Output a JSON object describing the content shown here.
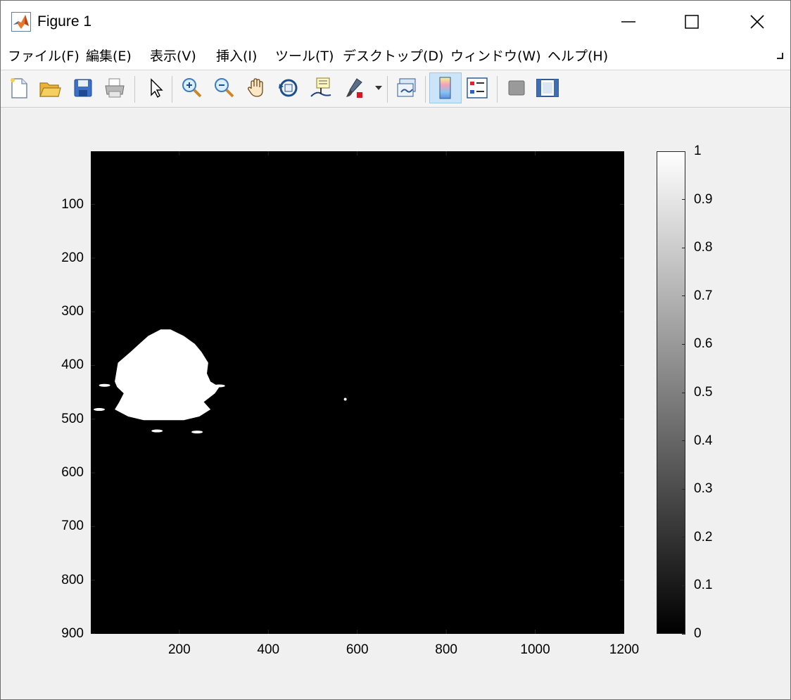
{
  "window": {
    "title": "Figure 1",
    "controls": {
      "minimize": "minimize",
      "maximize": "maximize",
      "close": "close"
    }
  },
  "menu": {
    "items": [
      "ファイル(F)",
      "編集(E)",
      "表示(V)",
      "挿入(I)",
      "ツール(T)",
      "デスクトップ(D)",
      "ウィンドウ(W)",
      "ヘルプ(H)"
    ]
  },
  "toolbar": {
    "buttons": [
      {
        "icon": "new-figure-icon"
      },
      {
        "icon": "open-file-icon"
      },
      {
        "icon": "save-icon"
      },
      {
        "icon": "print-icon"
      },
      {
        "icon": "edit-plot-arrow-icon"
      },
      {
        "icon": "zoom-in-icon"
      },
      {
        "icon": "zoom-out-icon"
      },
      {
        "icon": "pan-hand-icon"
      },
      {
        "icon": "rotate-3d-icon"
      },
      {
        "icon": "data-cursor-icon"
      },
      {
        "icon": "brush-icon"
      },
      {
        "icon": "link-plot-icon"
      },
      {
        "icon": "colorbar-icon",
        "active": true
      },
      {
        "icon": "legend-icon"
      },
      {
        "icon": "hide-plot-tools-icon"
      },
      {
        "icon": "show-plot-tools-icon"
      }
    ]
  },
  "chart_data": {
    "type": "heatmap",
    "title": "",
    "xlabel": "",
    "ylabel": "",
    "xlim": [
      1,
      1200
    ],
    "ylim": [
      1,
      900
    ],
    "y_reversed": true,
    "xticks": [
      200,
      400,
      600,
      800,
      1000,
      1200
    ],
    "yticks": [
      100,
      200,
      300,
      400,
      500,
      600,
      700,
      800,
      900
    ],
    "colormap": "gray",
    "background_value": 0,
    "foreground_value": 1,
    "white_region_profile": [
      {
        "y": 333,
        "x_from": 158,
        "x_to": 180
      },
      {
        "y": 345,
        "x_from": 130,
        "x_to": 210
      },
      {
        "y": 360,
        "x_from": 110,
        "x_to": 235
      },
      {
        "y": 375,
        "x_from": 90,
        "x_to": 250
      },
      {
        "y": 395,
        "x_from": 62,
        "x_to": 265
      },
      {
        "y": 415,
        "x_from": 58,
        "x_to": 262
      },
      {
        "y": 430,
        "x_from": 55,
        "x_to": 270
      },
      {
        "y": 440,
        "x_from": 60,
        "x_to": 290
      },
      {
        "y": 452,
        "x_from": 75,
        "x_to": 280
      },
      {
        "y": 468,
        "x_from": 65,
        "x_to": 255
      },
      {
        "y": 482,
        "x_from": 55,
        "x_to": 270
      },
      {
        "y": 495,
        "x_from": 85,
        "x_to": 245
      },
      {
        "y": 502,
        "x_from": 120,
        "x_to": 210
      }
    ],
    "extra_white_blobs": [
      {
        "x": 32,
        "y": 437
      },
      {
        "x": 290,
        "y": 438
      },
      {
        "x": 20,
        "y": 482
      },
      {
        "x": 150,
        "y": 522
      },
      {
        "x": 240,
        "y": 524
      },
      {
        "x": 573,
        "y": 463
      }
    ],
    "colorbar": {
      "limits": [
        0,
        1
      ],
      "ticks": [
        "0",
        "0.1",
        "0.2",
        "0.3",
        "0.4",
        "0.5",
        "0.6",
        "0.7",
        "0.8",
        "0.9",
        "1"
      ]
    }
  }
}
